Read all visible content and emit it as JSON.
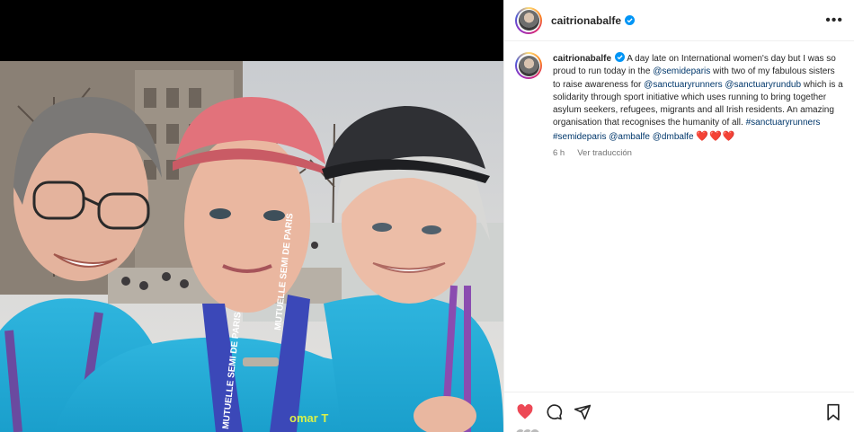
{
  "post": {
    "username": "caitrionabalfe",
    "caption": {
      "p1": "A day late on International women's day but I was so proud to run today in the ",
      "tag_semideparis": "@semideparis",
      "p2": " with two of my fabulous sisters to raise awareness for ",
      "tag_sanctuaryrunners": "@sanctuaryrunners",
      "tag_sanctuaryrundub": "@sanctuaryrundub",
      "p3": " which is a solidarity through sport initiative which uses running to bring together asylum seekers, refugees, migrants and all Irish residents. An amazing organisation that recognises the humanity of all. ",
      "hashtag_sanctuaryrunners": "#sanctuaryrunners",
      "hashtag_semideparis": "#semideparis",
      "tag_ambalfe": "@ambalfe",
      "tag_dmbalfe": "@dmbalfe",
      "hearts": "❤️❤️❤️"
    },
    "time_ago": "6 h",
    "translate_label": "Ver traducción",
    "liked": true
  },
  "photo": {
    "lanyard_text": "MUTUELLE SEMI DE PARIS",
    "shirt_text": "omar T"
  },
  "icons": {
    "more": "more-horizontal-icon",
    "like": "heart-icon",
    "comment": "comment-icon",
    "share": "send-icon",
    "save": "bookmark-icon",
    "verified": "verified-badge-icon"
  },
  "colors": {
    "like_active": "#ed4956",
    "verified": "#0095f6",
    "link": "#00376b",
    "meta": "#737373"
  }
}
